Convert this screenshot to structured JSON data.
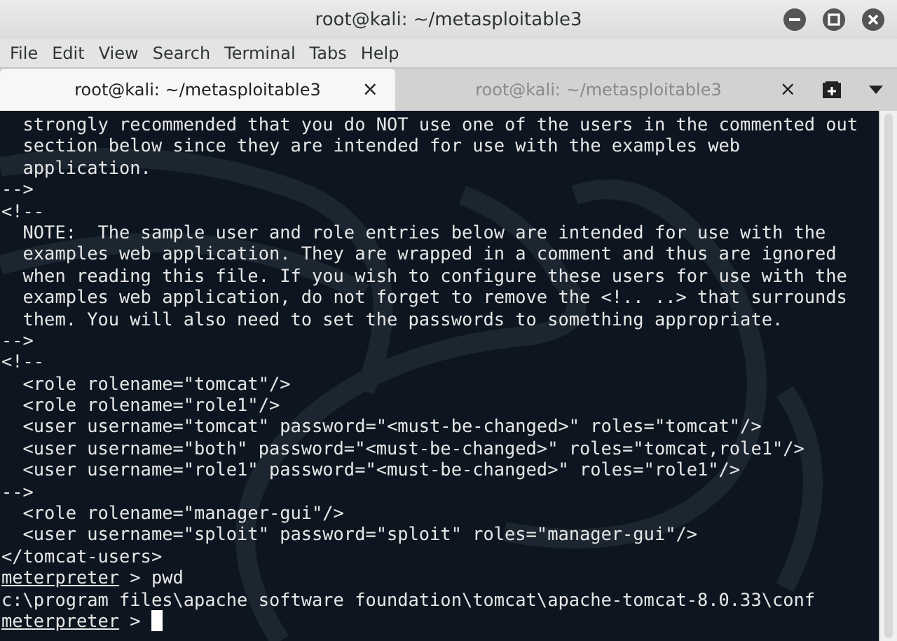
{
  "window": {
    "title": "root@kali: ~/metasploitable3"
  },
  "menu": [
    "File",
    "Edit",
    "View",
    "Search",
    "Terminal",
    "Tabs",
    "Help"
  ],
  "tabs": [
    {
      "label": "root@kali: ~/metasploitable3",
      "close": "×",
      "selected": true
    },
    {
      "label": "root@kali: ~/metasploitable3",
      "close": "×",
      "selected": false
    }
  ],
  "terminal": {
    "lines": [
      {
        "kind": "text",
        "text": "  strongly recommended that you do NOT use one of the users in the commented out"
      },
      {
        "kind": "text",
        "text": "  section below since they are intended for use with the examples web"
      },
      {
        "kind": "text",
        "text": "  application."
      },
      {
        "kind": "text",
        "text": "-->"
      },
      {
        "kind": "text",
        "text": "<!--"
      },
      {
        "kind": "text",
        "text": "  NOTE:  The sample user and role entries below are intended for use with the"
      },
      {
        "kind": "text",
        "text": "  examples web application. They are wrapped in a comment and thus are ignored"
      },
      {
        "kind": "text",
        "text": "  when reading this file. If you wish to configure these users for use with the"
      },
      {
        "kind": "text",
        "text": "  examples web application, do not forget to remove the <!.. ..> that surrounds"
      },
      {
        "kind": "text",
        "text": "  them. You will also need to set the passwords to something appropriate."
      },
      {
        "kind": "text",
        "text": "-->"
      },
      {
        "kind": "text",
        "text": "<!--"
      },
      {
        "kind": "text",
        "text": "  <role rolename=\"tomcat\"/>"
      },
      {
        "kind": "text",
        "text": "  <role rolename=\"role1\"/>"
      },
      {
        "kind": "text",
        "text": "  <user username=\"tomcat\" password=\"<must-be-changed>\" roles=\"tomcat\"/>"
      },
      {
        "kind": "text",
        "text": "  <user username=\"both\" password=\"<must-be-changed>\" roles=\"tomcat,role1\"/>"
      },
      {
        "kind": "text",
        "text": "  <user username=\"role1\" password=\"<must-be-changed>\" roles=\"role1\"/>"
      },
      {
        "kind": "text",
        "text": "-->"
      },
      {
        "kind": "text",
        "text": "  <role rolename=\"manager-gui\"/>"
      },
      {
        "kind": "text",
        "text": "  <user username=\"sploit\" password=\"sploit\" roles=\"manager-gui\"/>"
      },
      {
        "kind": "text",
        "text": "</tomcat-users>"
      },
      {
        "kind": "prompt",
        "prompt": "meterpreter",
        "text": " > pwd",
        "cursor": false
      },
      {
        "kind": "text",
        "text": "c:\\program files\\apache software foundation\\tomcat\\apache-tomcat-8.0.33\\conf"
      },
      {
        "kind": "prompt",
        "prompt": "meterpreter",
        "text": " > ",
        "cursor": true
      }
    ]
  }
}
